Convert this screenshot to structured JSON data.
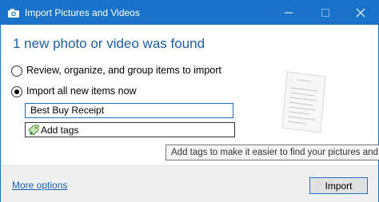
{
  "window": {
    "title": "Import Pictures and Videos",
    "icon": "camera-icon",
    "controls": [
      "minimize-icon",
      "maximize-icon",
      "close-icon"
    ]
  },
  "main": {
    "heading": "1 new photo or video was found",
    "options": [
      {
        "label": "Review, organize, and group items to import",
        "selected": false
      },
      {
        "label": "Import all new items now",
        "selected": true
      }
    ],
    "name_input": {
      "value": "Best Buy Receipt"
    },
    "tags": {
      "label": "Add tags",
      "icon": "tag-icon"
    },
    "preview": {
      "icon": "receipt-thumbnail"
    }
  },
  "tooltip": {
    "text": "Add tags to make it easier to find your pictures and v"
  },
  "footer": {
    "more_options": "More options",
    "import_label": "Import"
  },
  "colors": {
    "title_bar": "#1a73c9",
    "heading": "#1c5ea8",
    "link": "#1a5fb4",
    "footer_bg": "#f0f0f0"
  }
}
